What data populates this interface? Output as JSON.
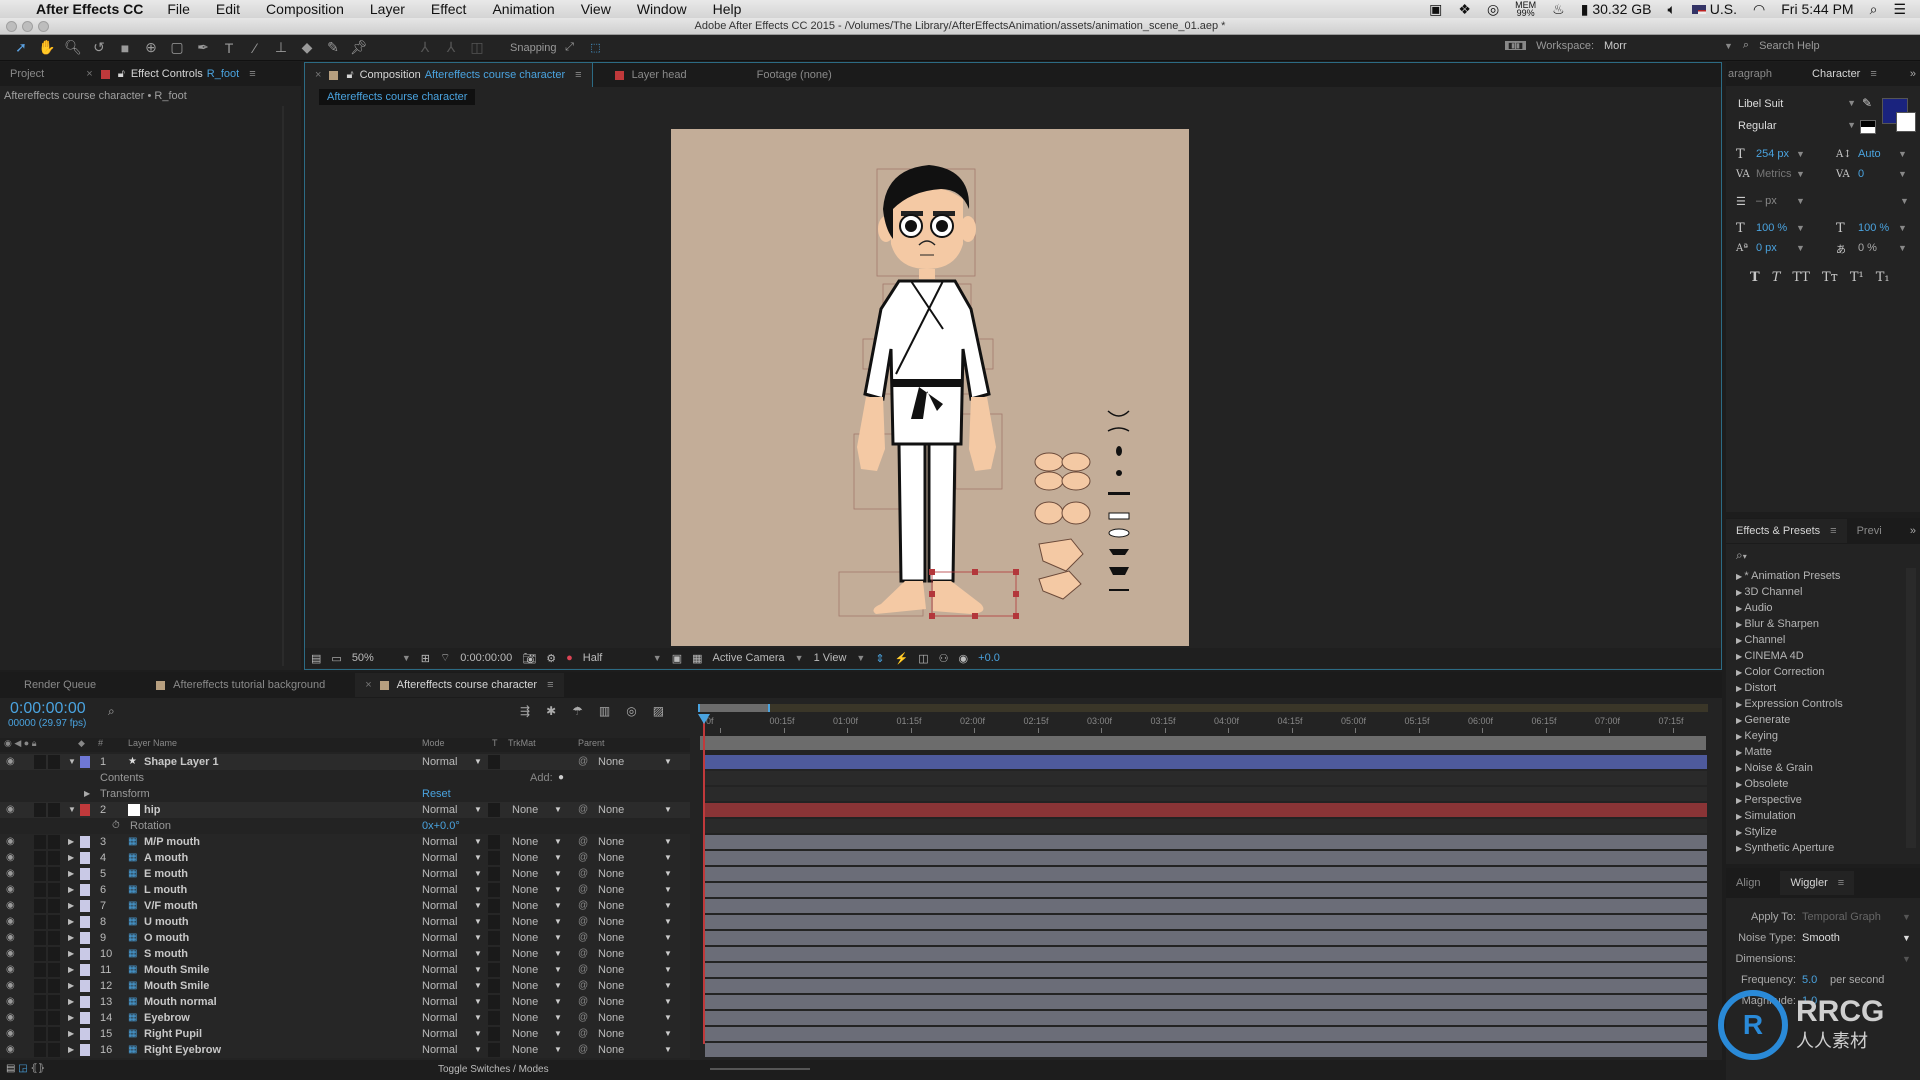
{
  "menubar": {
    "app_name": "After Effects CC",
    "items": [
      "File",
      "Edit",
      "Composition",
      "Layer",
      "Effect",
      "Animation",
      "View",
      "Window",
      "Help"
    ],
    "status": {
      "mem_label": "MEM",
      "mem_value": "99%",
      "disk": "30.32 GB",
      "input_source": "U.S.",
      "clock": "Fri 5:44 PM"
    }
  },
  "titlebar": {
    "title": "Adobe After Effects CC 2015 - /Volumes/The Library/AfterEffectsAnimation/assets/animation_scene_01.aep *"
  },
  "toolbar": {
    "snapping_label": "Snapping",
    "workspace_label": "Workspace:",
    "workspace_value": "Morr",
    "search_placeholder": "Search Help"
  },
  "left_panel": {
    "tabs": [
      {
        "label": "Project"
      },
      {
        "label": "Effect Controls",
        "target": "R_foot"
      }
    ],
    "breadcrumb": "Aftereffects course character • R_foot"
  },
  "viewer": {
    "tabs": [
      {
        "prefix": "Composition",
        "label": "Aftereffects course character"
      },
      {
        "label": "Layer head"
      },
      {
        "label": "Footage (none)"
      }
    ],
    "comp_tab": "Aftereffects course character",
    "zoom": "50%",
    "timecode": "0:00:00:00",
    "resolution": "Half",
    "camera": "Active Camera",
    "views": "1 View",
    "exposure": "+0.0",
    "accent": "#4aa3df",
    "canvas_color": "#c3ad98"
  },
  "character_panel": {
    "tabs": [
      {
        "label": "aragraph"
      },
      {
        "label": "Character"
      }
    ],
    "font": "Libel Suit",
    "style": "Regular",
    "size": "254 px",
    "leading": "Auto",
    "kerning": "Metrics",
    "tracking": "0",
    "stroke": "– px",
    "vscale": "100 %",
    "hscale": "100 %",
    "baseline": "0 px",
    "tsume": "0 %",
    "fill_color": "#1a237e",
    "type_buttons": [
      "T",
      "T",
      "TT",
      "Tт",
      "T¹",
      "T₁"
    ]
  },
  "effects_panel": {
    "tabs": [
      {
        "label": "Effects & Presets"
      },
      {
        "label": "Previ"
      }
    ],
    "items": [
      "* Animation Presets",
      "3D Channel",
      "Audio",
      "Blur & Sharpen",
      "Channel",
      "CINEMA 4D",
      "Color Correction",
      "Distort",
      "Expression Controls",
      "Generate",
      "Keying",
      "Matte",
      "Noise & Grain",
      "Obsolete",
      "Perspective",
      "Simulation",
      "Stylize",
      "Synthetic Aperture"
    ]
  },
  "wiggler_panel": {
    "tabs": [
      {
        "label": "Align"
      },
      {
        "label": "Wiggler"
      }
    ],
    "apply_to_label": "Apply To:",
    "apply_to_value": "Temporal Graph",
    "noise_type_label": "Noise Type:",
    "noise_type_value": "Smooth",
    "dimensions_label": "Dimensions:",
    "frequency_label": "Frequency:",
    "frequency_value": "5.0",
    "frequency_unit": "per second",
    "magnitude_label": "Magnitude:",
    "magnitude_value": "1.0"
  },
  "timeline": {
    "tabs": [
      {
        "label": "Render Queue"
      },
      {
        "label": "Aftereffects tutorial background"
      },
      {
        "label": "Aftereffects course character"
      }
    ],
    "current_time": "0:00:00:00",
    "frame_info": "00000 (29.97 fps)",
    "columns": {
      "layer_name": "Layer Name",
      "mode": "Mode",
      "t": "T",
      "trkmat": "TrkMat",
      "parent": "Parent",
      "num": "#"
    },
    "ruler": [
      "0f",
      "00:15f",
      "01:00f",
      "01:15f",
      "02:00f",
      "02:15f",
      "03:00f",
      "03:15f",
      "04:00f",
      "04:15f",
      "05:00f",
      "05:15f",
      "06:00f",
      "06:15f",
      "07:00f",
      "07:15f"
    ],
    "layers": [
      {
        "num": "1",
        "name": "Shape Layer 1",
        "type": "shape",
        "label_color": "#6f78d6",
        "mode": "Normal",
        "trkmat": "",
        "parent": "None",
        "bar_color": "#4e5a9c"
      },
      {
        "sub": "Contents",
        "right": "Add:"
      },
      {
        "sub": "Transform",
        "right": "Reset",
        "expandable": true
      },
      {
        "num": "2",
        "name": "hip",
        "type": "solid",
        "label_color": "#c0393b",
        "mode": "Normal",
        "trkmat": "None",
        "parent": "None",
        "bar_color": "#8a3436"
      },
      {
        "sub": "Rotation",
        "right": "0x+0.0°",
        "stopwatch": true
      },
      {
        "num": "3",
        "name": "M/P mouth",
        "type": "ps",
        "label_color": "#c9c9e6",
        "mode": "Normal",
        "trkmat": "None",
        "parent": "None",
        "bar_color": "#6b6d78"
      },
      {
        "num": "4",
        "name": "A mouth",
        "type": "ps",
        "label_color": "#c9c9e6",
        "mode": "Normal",
        "trkmat": "None",
        "parent": "None",
        "bar_color": "#6b6d78"
      },
      {
        "num": "5",
        "name": "E mouth",
        "type": "ps",
        "label_color": "#c9c9e6",
        "mode": "Normal",
        "trkmat": "None",
        "parent": "None",
        "bar_color": "#6b6d78"
      },
      {
        "num": "6",
        "name": "L mouth",
        "type": "ps",
        "label_color": "#c9c9e6",
        "mode": "Normal",
        "trkmat": "None",
        "parent": "None",
        "bar_color": "#6b6d78"
      },
      {
        "num": "7",
        "name": "V/F mouth",
        "type": "ps",
        "label_color": "#c9c9e6",
        "mode": "Normal",
        "trkmat": "None",
        "parent": "None",
        "bar_color": "#6b6d78"
      },
      {
        "num": "8",
        "name": "U mouth",
        "type": "ps",
        "label_color": "#c9c9e6",
        "mode": "Normal",
        "trkmat": "None",
        "parent": "None",
        "bar_color": "#6b6d78"
      },
      {
        "num": "9",
        "name": "O mouth",
        "type": "ps",
        "label_color": "#c9c9e6",
        "mode": "Normal",
        "trkmat": "None",
        "parent": "None",
        "bar_color": "#6b6d78"
      },
      {
        "num": "10",
        "name": "S mouth",
        "type": "ps",
        "label_color": "#c9c9e6",
        "mode": "Normal",
        "trkmat": "None",
        "parent": "None",
        "bar_color": "#6b6d78"
      },
      {
        "num": "11",
        "name": "Mouth Smile",
        "type": "ps",
        "label_color": "#c9c9e6",
        "mode": "Normal",
        "trkmat": "None",
        "parent": "None",
        "bar_color": "#6b6d78"
      },
      {
        "num": "12",
        "name": "Mouth Smile",
        "type": "ps",
        "label_color": "#c9c9e6",
        "mode": "Normal",
        "trkmat": "None",
        "parent": "None",
        "bar_color": "#6b6d78"
      },
      {
        "num": "13",
        "name": "Mouth normal",
        "type": "ps",
        "label_color": "#c9c9e6",
        "mode": "Normal",
        "trkmat": "None",
        "parent": "None",
        "bar_color": "#6b6d78"
      },
      {
        "num": "14",
        "name": "Eyebrow",
        "type": "ps",
        "label_color": "#c9c9e6",
        "mode": "Normal",
        "trkmat": "None",
        "parent": "None",
        "bar_color": "#6b6d78"
      },
      {
        "num": "15",
        "name": "Right Pupil",
        "type": "ps",
        "label_color": "#c9c9e6",
        "mode": "Normal",
        "trkmat": "None",
        "parent": "None",
        "bar_color": "#6b6d78"
      },
      {
        "num": "16",
        "name": "Right Eyebrow",
        "type": "ps",
        "label_color": "#c9c9e6",
        "mode": "Normal",
        "trkmat": "None",
        "parent": "None",
        "bar_color": "#6b6d78"
      }
    ],
    "footer_toggle": "Toggle Switches / Modes"
  },
  "watermark": {
    "brand": "RRCG",
    "sub": "人人素材"
  }
}
